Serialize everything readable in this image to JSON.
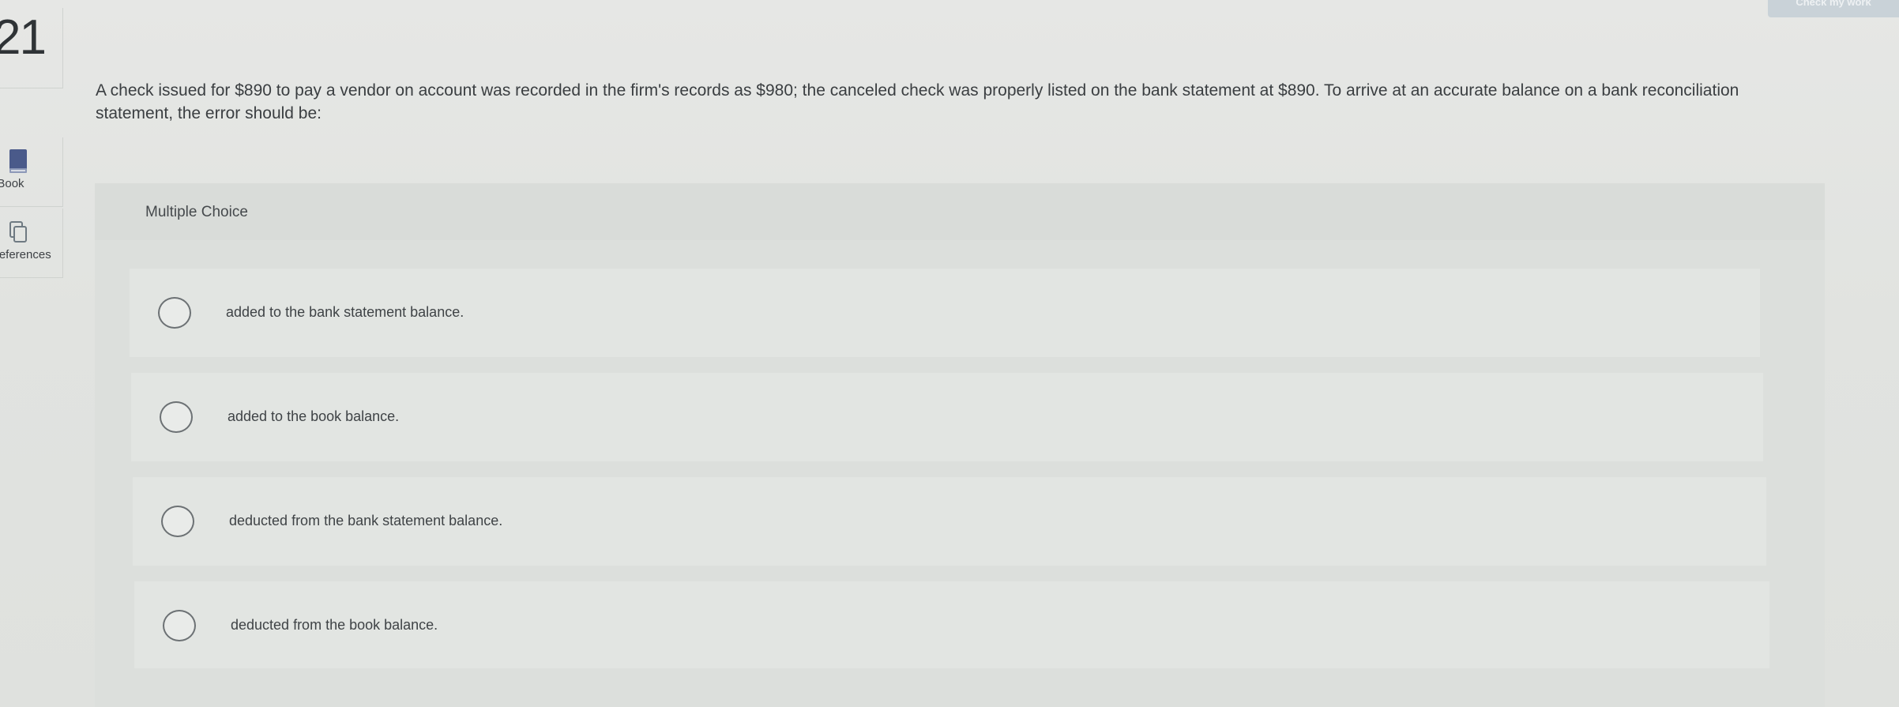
{
  "header": {
    "question_number": "21",
    "check_button_label": "Check my work"
  },
  "sidebar": {
    "items": [
      {
        "label": "eBook",
        "icon": "book-icon"
      },
      {
        "label": "References",
        "icon": "copy-icon"
      }
    ]
  },
  "question": {
    "text": "A check issued for $890 to pay a vendor on account was recorded in the firm's records as $980; the canceled check was properly listed on the bank statement at $890. To arrive at an accurate balance on a bank reconciliation statement, the error should be:"
  },
  "choices": {
    "title": "Multiple Choice",
    "options": [
      {
        "label": "added to the bank statement balance."
      },
      {
        "label": "added to the book balance."
      },
      {
        "label": "deducted from the bank statement balance."
      },
      {
        "label": "deducted from the book balance."
      }
    ]
  },
  "colors": {
    "background": "#e3e5e2",
    "panel": "#dcdfdc",
    "option_row": "#e2e5e2",
    "accent_icon": "#4a5a8a"
  }
}
